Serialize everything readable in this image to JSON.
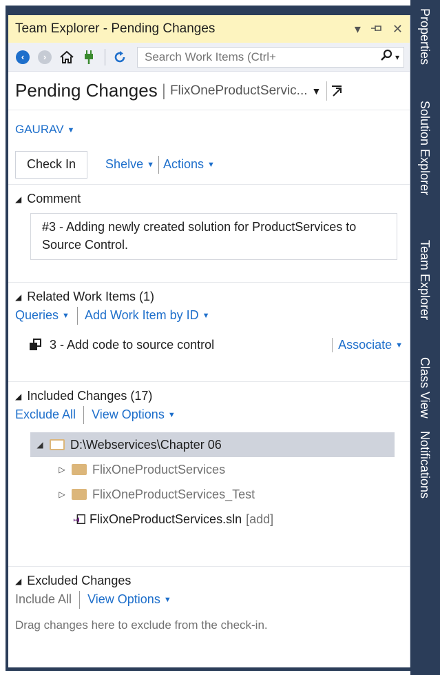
{
  "window": {
    "title": "Team Explorer - Pending Changes"
  },
  "toolbar": {
    "search_placeholder": "Search Work Items (Ctrl+"
  },
  "header": {
    "title": "Pending Changes",
    "separator": "|",
    "project": "FlixOneProductServic..."
  },
  "user": {
    "name": "GAURAV"
  },
  "actions": {
    "check_in": "Check In",
    "shelve": "Shelve",
    "actions": "Actions"
  },
  "comment": {
    "heading": "Comment",
    "text": "#3 - Adding newly created solution for ProductServices to Source Control."
  },
  "related": {
    "heading": "Related Work Items (1)",
    "queries": "Queries",
    "add_by_id": "Add Work Item by ID",
    "item": "3 - Add code to source control",
    "associate": "Associate"
  },
  "included": {
    "heading": "Included Changes (17)",
    "exclude_all": "Exclude All",
    "view_options": "View Options",
    "root_path": "D:\\Webservices\\Chapter 06",
    "children": [
      {
        "name": "FlixOneProductServices"
      },
      {
        "name": "FlixOneProductServices_Test"
      }
    ],
    "file_name": "FlixOneProductServices.sln",
    "file_status": "[add]"
  },
  "excluded": {
    "heading": "Excluded Changes",
    "include_all": "Include All",
    "view_options": "View Options",
    "hint": "Drag changes here to exclude from the check-in."
  },
  "side_tabs": {
    "properties": "Properties",
    "solution_explorer": "Solution Explorer",
    "team_explorer": "Team Explorer",
    "class_view": "Class View",
    "notifications": "Notifications"
  },
  "colors": {
    "title_bar": "#fdf4bf",
    "frame": "#2b3d59",
    "link": "#1e6fcb",
    "selected_row": "#cfd3dc"
  }
}
